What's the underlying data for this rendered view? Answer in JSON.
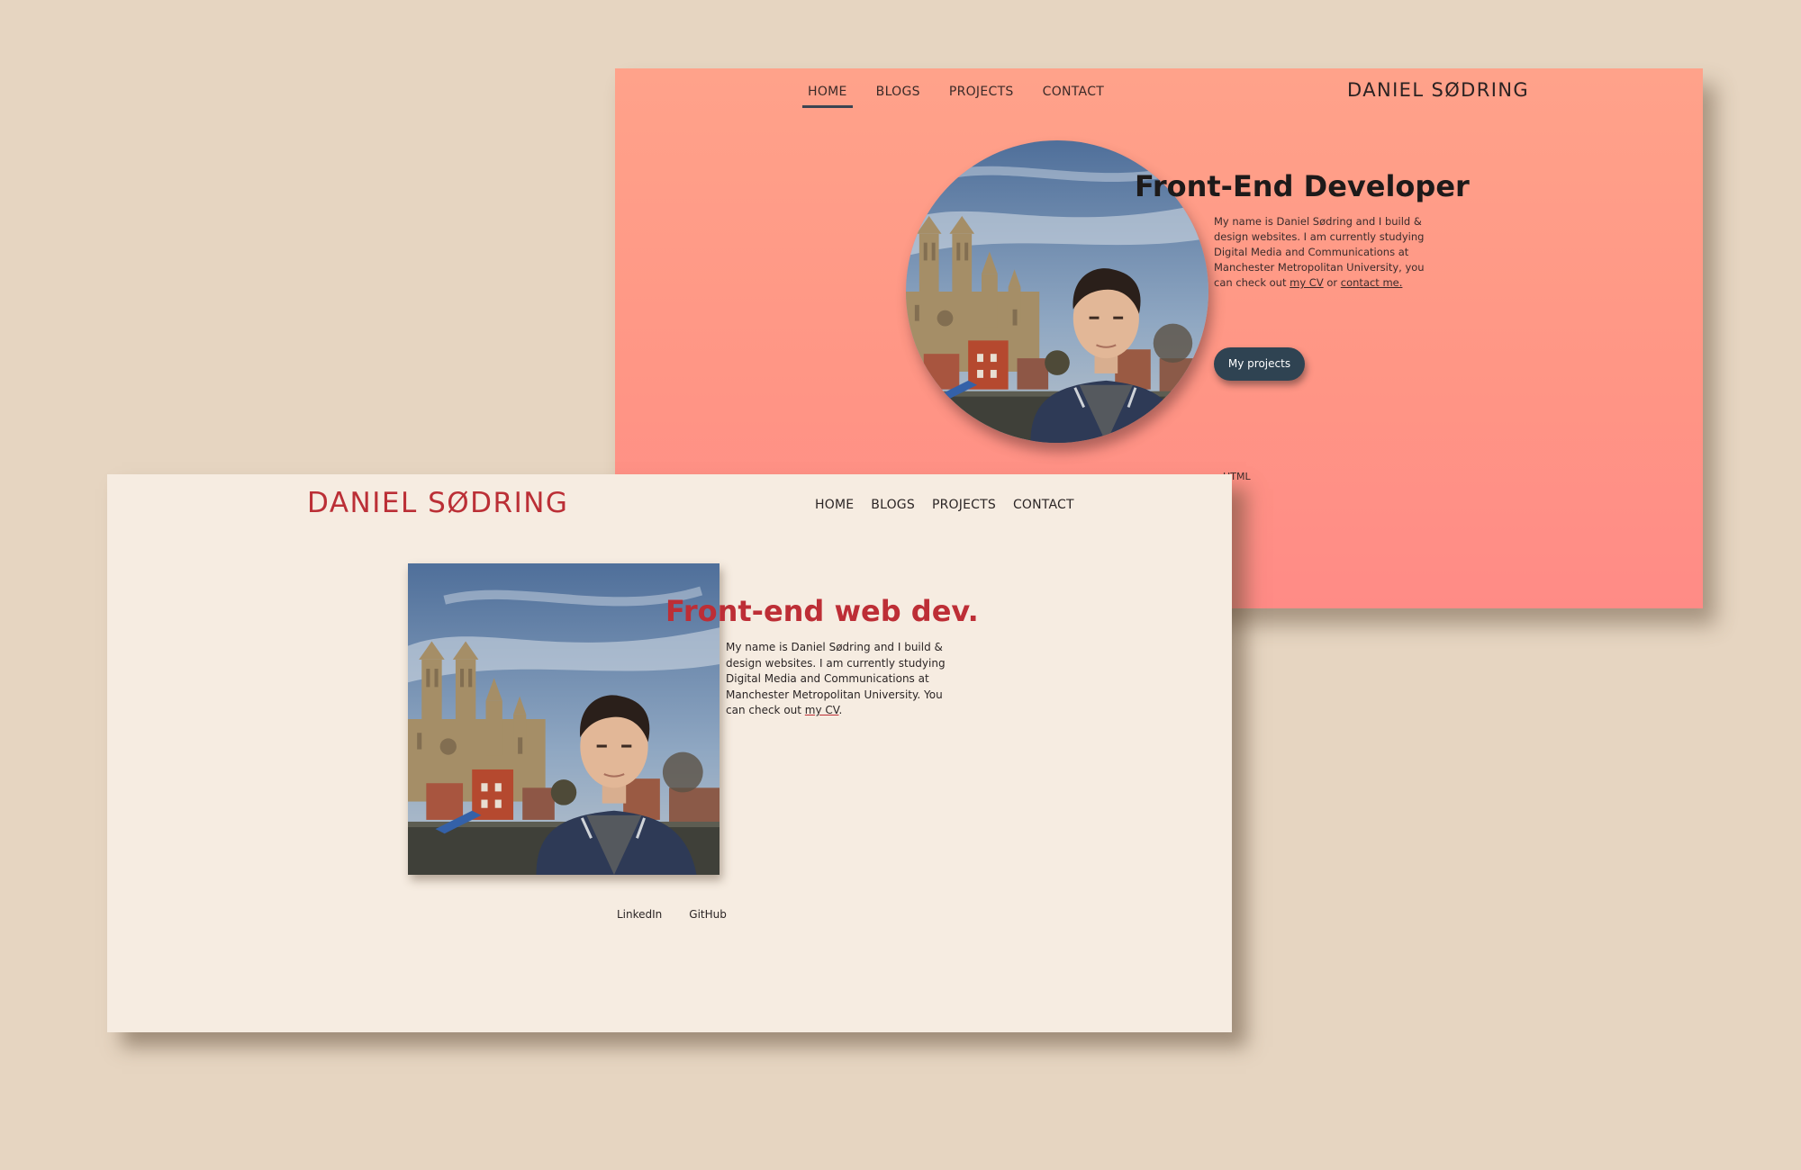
{
  "back_window": {
    "nav": [
      "HOME",
      "BLOGS",
      "PROJECTS",
      "CONTACT"
    ],
    "brand": "DANIEL SØDRING",
    "headline": "Front-End Developer",
    "intro_text": "My name is Daniel Sødring and I build & design websites. I am currently studying Digital Media and Communications at Manchester Metropolitan University, you can check out ",
    "cv_link": "my CV",
    "or_text": " or ",
    "contact_link": "contact me.",
    "button": "My projects",
    "stack_label": "HTML"
  },
  "front_window": {
    "brand": "DANIEL SØDRING",
    "nav": [
      "HOME",
      "BLOGS",
      "PROJECTS",
      "CONTACT"
    ],
    "headline": "Front-end web dev.",
    "intro_text": "My name is Daniel Sødring and I build & design websites. I am currently studying Digital Media and Communications at Manchester Metropolitan University. You can check out ",
    "cv_link": "my CV",
    "intro_end": ".",
    "social": [
      "LinkedIn",
      "GitHub"
    ]
  },
  "colors": {
    "page_bg": "#e6d5c1",
    "coral_top": "#ffa28a",
    "coral_bottom": "#ff8b86",
    "cream": "#f6ece1",
    "brand_red": "#bb2f36",
    "button_dark": "#2f4352"
  }
}
